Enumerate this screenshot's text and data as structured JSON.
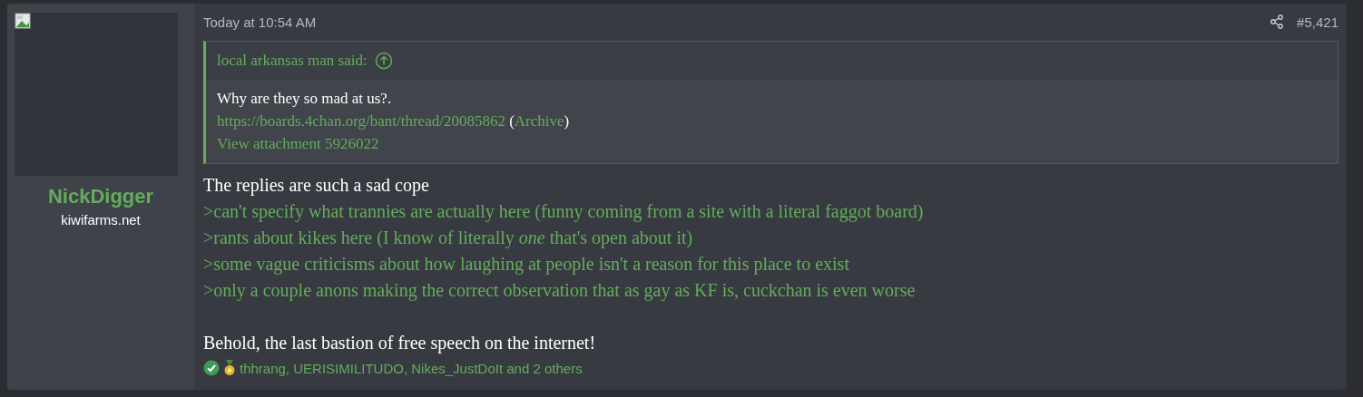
{
  "post": {
    "author": {
      "name": "NickDigger",
      "site": "kiwifarms.net"
    },
    "timestamp": "Today at 10:54 AM",
    "post_number": "#5,421",
    "quote": {
      "attribution": "local arkansas man said:",
      "text": "Why are they so mad at us?.",
      "link_line": [
        {
          "kind": "link",
          "text": "https://boards.4chan.org/bant/thread/20085862"
        },
        {
          "kind": "plain",
          "text": " ("
        },
        {
          "kind": "link",
          "text": "Archive"
        },
        {
          "kind": "plain",
          "text": ")"
        }
      ],
      "attachment": "View attachment 5926022"
    },
    "body": [
      {
        "lines": [
          {
            "kind": "plain",
            "text": "The replies are such a sad cope"
          },
          {
            "kind": "greentext",
            "text": ">can't specify what trannies are actually here (funny coming from a site with a literal faggot board)"
          },
          {
            "kind": "greentext",
            "text": ">rants about kikes here (I know of literally *one* that's open about it)"
          },
          {
            "kind": "greentext",
            "text": ">some vague criticisms about how laughing at people isn't a reason for this place to exist"
          },
          {
            "kind": "greentext",
            "text": ">only a couple anons making the correct observation that as gay as KF is, cuckchan is even worse"
          }
        ]
      },
      {
        "lines": [
          {
            "kind": "plain",
            "text": "Behold, the last bastion of free speech on the internet!"
          }
        ]
      }
    ],
    "reactions": {
      "users": "thhrang, UERISIMILITUDO, Nikes_JustDoIt and 2 others"
    }
  }
}
